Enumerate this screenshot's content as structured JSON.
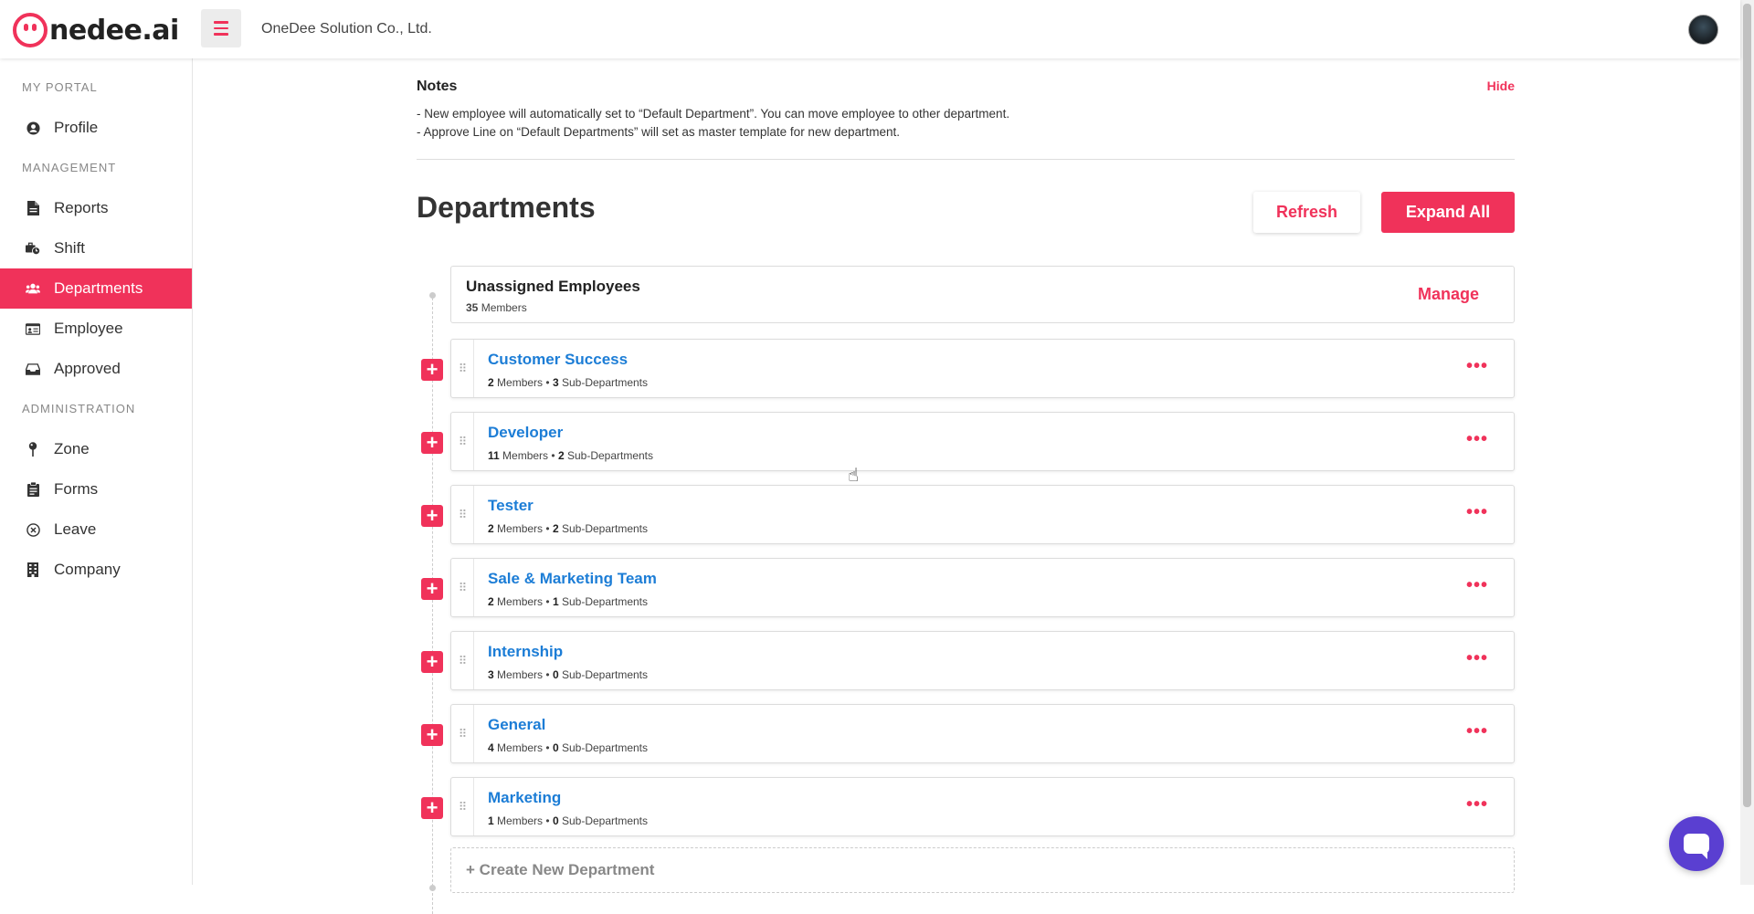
{
  "header": {
    "logo_text": "nedee.ai",
    "company": "OneDee Solution Co., Ltd."
  },
  "sidebar": {
    "sections": [
      {
        "label": "MY PORTAL"
      },
      {
        "label": "MANAGEMENT"
      },
      {
        "label": "ADMINISTRATION"
      }
    ],
    "items": [
      {
        "label": "Profile",
        "icon": "user-circle-icon"
      },
      {
        "label": "Reports",
        "icon": "file-icon"
      },
      {
        "label": "Shift",
        "icon": "briefcase-clock-icon"
      },
      {
        "label": "Departments",
        "icon": "users-icon",
        "active": true
      },
      {
        "label": "Employee",
        "icon": "id-card-icon"
      },
      {
        "label": "Approved",
        "icon": "inbox-icon"
      },
      {
        "label": "Zone",
        "icon": "pin-icon"
      },
      {
        "label": "Forms",
        "icon": "clipboard-icon"
      },
      {
        "label": "Leave",
        "icon": "circle-x-icon"
      },
      {
        "label": "Company",
        "icon": "building-icon"
      }
    ]
  },
  "notes": {
    "title": "Notes",
    "hide": "Hide",
    "lines": [
      "- New employee will automatically set to “Default Department”. You can move employee to other department.",
      "- Approve Line on “Default Departments” will set as master template for new department."
    ]
  },
  "departments": {
    "title": "Departments",
    "refresh_label": "Refresh",
    "expand_label": "Expand All",
    "unassigned": {
      "title": "Unassigned Employees",
      "count": "35",
      "count_label": "Members",
      "manage_label": "Manage"
    },
    "list": [
      {
        "name": "Customer Success",
        "members": "2",
        "subs": "3"
      },
      {
        "name": "Developer",
        "members": "11",
        "subs": "2"
      },
      {
        "name": "Tester",
        "members": "2",
        "subs": "2"
      },
      {
        "name": "Sale & Marketing Team",
        "members": "2",
        "subs": "1"
      },
      {
        "name": "Internship",
        "members": "3",
        "subs": "0"
      },
      {
        "name": "General",
        "members": "4",
        "subs": "0"
      },
      {
        "name": "Marketing",
        "members": "1",
        "subs": "0"
      }
    ],
    "members_label": "Members",
    "subs_label": "Sub-Departments",
    "separator": "•",
    "create_label": "Create New Department",
    "create_prefix": "+"
  },
  "colors": {
    "accent": "#f0325a",
    "link": "#1c7dd6",
    "chat": "#5a3fd1"
  }
}
